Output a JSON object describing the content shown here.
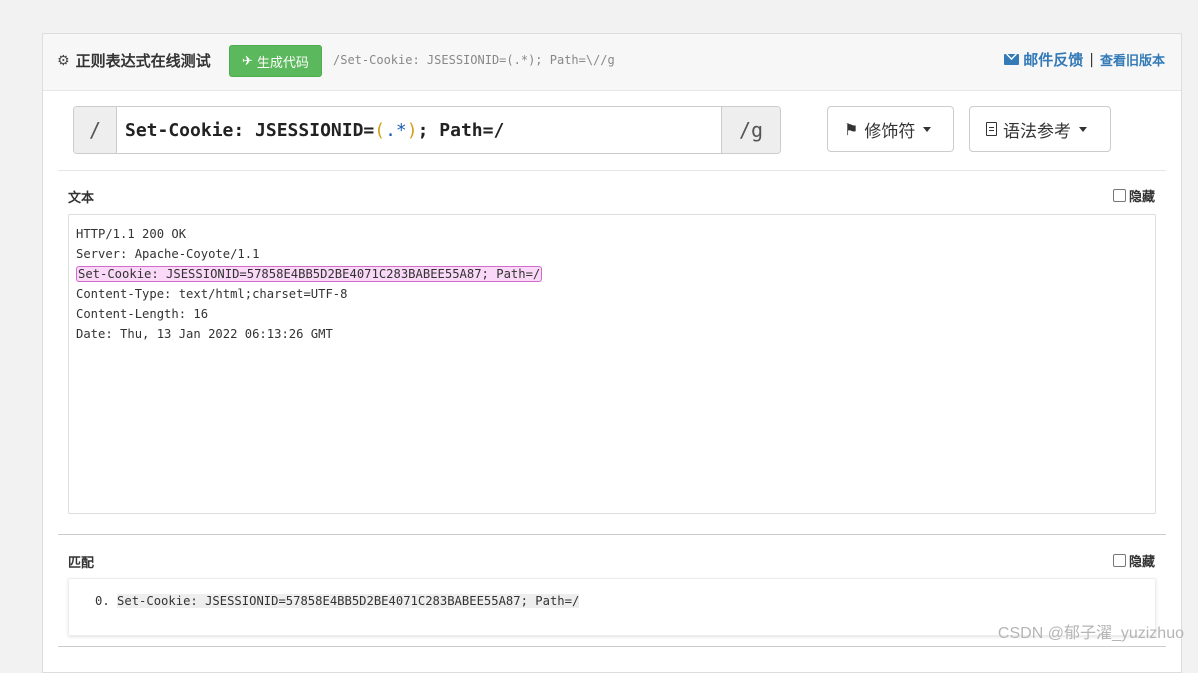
{
  "header": {
    "title": "正则表达式在线测试",
    "generate_button": "生成代码",
    "regex_preview": "/Set-Cookie: JSESSIONID=(.*); Path=\\//g",
    "mail_link": "邮件反馈",
    "separator": "|",
    "old_version_link": "查看旧版本"
  },
  "regex": {
    "left_delim": "/",
    "part1": "Set-Cookie: JSESSIONID=",
    "paren_open": "(",
    "meta": ".*",
    "paren_close": ")",
    "part2": "; Path=/",
    "flags": "/g"
  },
  "toolbar": {
    "modifiers_label": "修饰符",
    "syntax_label": "语法参考"
  },
  "text_section": {
    "label": "文本",
    "hide_label": "隐藏",
    "lines": [
      "HTTP/1.1 200 OK",
      "Server: Apache-Coyote/1.1",
      "Set-Cookie: JSESSIONID=57858E4BB5D2BE4071C283BABEE55A87; Path=/",
      "Content-Type: text/html;charset=UTF-8",
      "Content-Length: 16",
      "Date: Thu, 13 Jan 2022 06:13:26 GMT"
    ]
  },
  "match_section": {
    "label": "匹配",
    "hide_label": "隐藏",
    "index": "0.",
    "value": "Set-Cookie: JSESSIONID=57858E4BB5D2BE4071C283BABEE55A87; Path=/"
  },
  "watermark": "CSDN @郁子濯_yuzizhuo",
  "colors": {
    "generate_button": "#5cb85c",
    "link": "#337ab7",
    "highlight_bg": "#f9d9f7",
    "highlight_border": "#d36cc9"
  }
}
